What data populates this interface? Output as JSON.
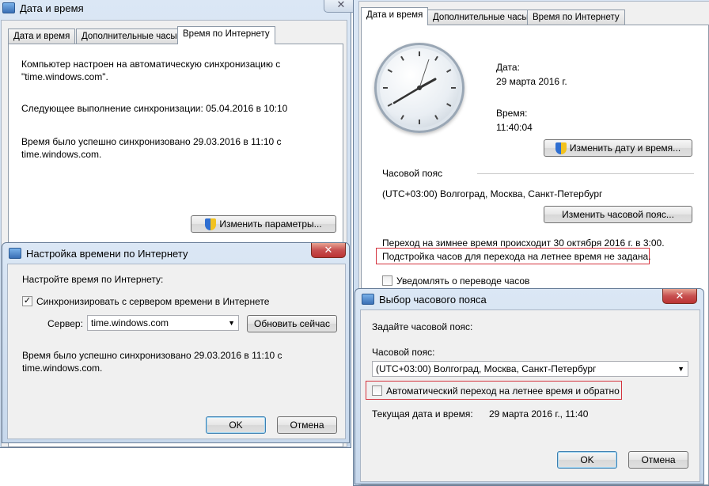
{
  "left_window": {
    "title": "Дата и время",
    "tabs": [
      "Дата и время",
      "Дополнительные часы",
      "Время по Интернету"
    ],
    "sync_info_line1": "Компьютер настроен на автоматическую синхронизацию с",
    "sync_info_line2": "\"time.windows.com\".",
    "next_sync": "Следующее выполнение синхронизации: 05.04.2016 в 10:10",
    "last_sync_line1": "Время было успешно синхронизовано 29.03.2016 в 11:10 с",
    "last_sync_line2": "time.windows.com.",
    "change_settings_button": "Изменить параметры..."
  },
  "internet_time_dialog": {
    "title": "Настройка времени по Интернету",
    "heading": "Настройте время по Интернету:",
    "sync_checkbox_label": "Синхронизировать с сервером времени в Интернете",
    "sync_checked": true,
    "server_label": "Сервер:",
    "server_value": "time.windows.com",
    "update_now_button": "Обновить сейчас",
    "status_line1": "Время было успешно синхронизовано 29.03.2016 в 11:10 с",
    "status_line2": "time.windows.com.",
    "ok_button": "OK",
    "cancel_button": "Отмена"
  },
  "right_window": {
    "tabs": [
      "Дата и время",
      "Дополнительные часы",
      "Время по Интернету"
    ],
    "date_label": "Дата:",
    "date_value": "29 марта 2016 г.",
    "time_label": "Время:",
    "time_value": "11:40:04",
    "change_datetime_button": "Изменить дату и время...",
    "timezone_section": "Часовой пояс",
    "timezone_value": "(UTC+03:00) Волгоград, Москва, Санкт-Петербург",
    "change_timezone_button": "Изменить часовой пояс...",
    "dst_line1": "Переход на зимнее время происходит 30 октября 2016 г. в 3:00.",
    "dst_line2": "Подстройка часов для перехода на летнее время не задана.",
    "notify_checkbox_label": "Уведомлять о переводе часов",
    "notify_checked": false
  },
  "timezone_dialog": {
    "title": "Выбор часового пояса",
    "heading": "Задайте часовой пояс:",
    "tz_label": "Часовой пояс:",
    "tz_value": "(UTC+03:00) Волгоград, Москва, Санкт-Петербург",
    "auto_dst_label": "Автоматический переход на летнее время и обратно",
    "auto_dst_checked": false,
    "current_label": "Текущая дата и время:",
    "current_value": "29 марта 2016 г., 11:40",
    "ok_button": "OK",
    "cancel_button": "Отмена"
  },
  "colors": {
    "highlight_box": "#d4323c",
    "default_button_border": "#3c7fb1"
  }
}
